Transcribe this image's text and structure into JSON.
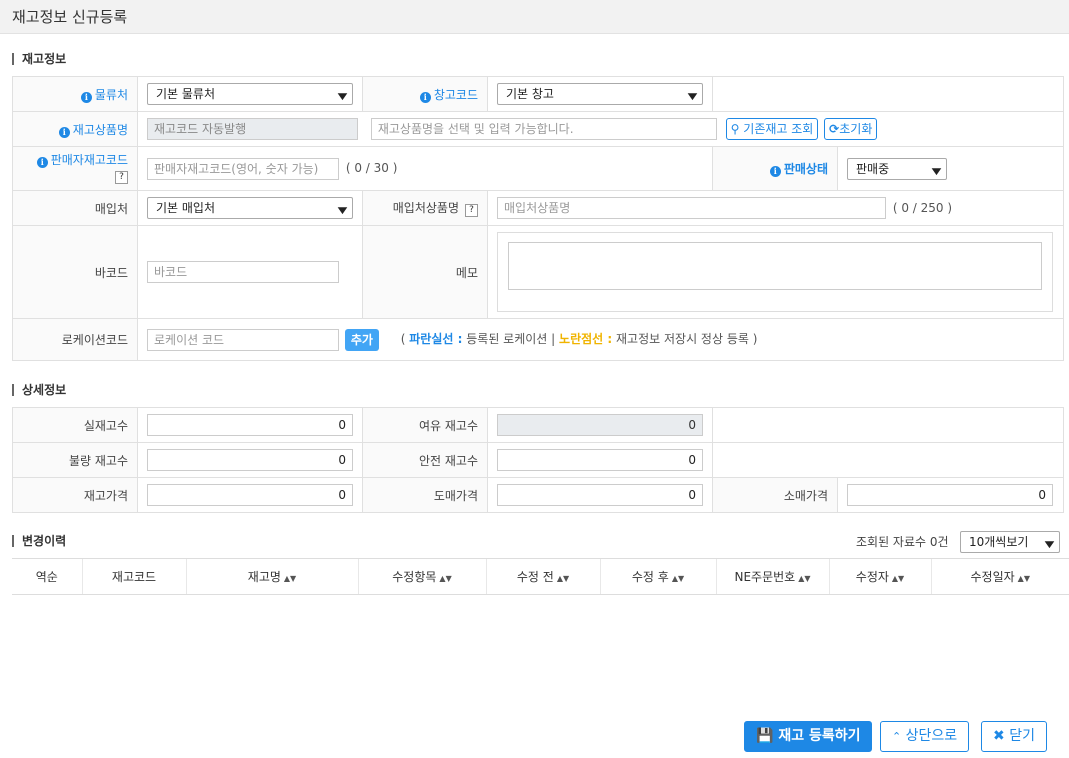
{
  "window": {
    "title": "재고정보 신규등록"
  },
  "sections": {
    "stock_info": "재고정보",
    "detail_info": "상세정보",
    "history": "변경이력"
  },
  "stock": {
    "distributor": {
      "label": "물류처",
      "value": "기본 물류처"
    },
    "warehouse": {
      "label": "창고코드",
      "value": "기본 창고"
    },
    "product_name": {
      "label": "재고상품명",
      "auto_value": "재고코드 자동발행",
      "placeholder": "재고상품명을 선택 및 입력 가능합니다.",
      "lookup_button": "기존재고 조회",
      "reset_button": "초기화"
    },
    "seller_code": {
      "label": "판매자재고코드",
      "help": "?",
      "placeholder": "판매자재고코드(영어, 숫자 가능)",
      "counter": "( 0 / 30 )"
    },
    "sale_status": {
      "label": "판매상태",
      "value": "판매중"
    },
    "purchaser": {
      "label": "매입처",
      "value": "기본 매입처"
    },
    "purchaser_product": {
      "label": "매입처상품명",
      "help": "?",
      "placeholder": "매입처상품명",
      "counter": "( 0 / 250 )"
    },
    "barcode": {
      "label": "바코드",
      "placeholder": "바코드"
    },
    "memo": {
      "label": "메모",
      "value": ""
    },
    "location": {
      "label": "로케이션코드",
      "placeholder": "로케이션 코드",
      "add_button": "추가",
      "legend": {
        "open": "(",
        "blue_term": "파란실선 :",
        "blue_desc": "등록된 로케이션",
        "sep": "|",
        "yellow_term": "노란점선 :",
        "yellow_desc": "재고정보 저장시 정상 등록",
        "close": ")"
      }
    }
  },
  "detail": {
    "actual_qty": {
      "label": "실재고수",
      "value": "0"
    },
    "spare_qty": {
      "label": "여유 재고수",
      "value": "0"
    },
    "defect_qty": {
      "label": "불량 재고수",
      "value": "0"
    },
    "safety_qty": {
      "label": "안전 재고수",
      "value": "0"
    },
    "stock_price": {
      "label": "재고가격",
      "value": "0"
    },
    "wholesale_price": {
      "label": "도매가격",
      "value": "0"
    },
    "retail_price": {
      "label": "소매가격",
      "value": "0"
    }
  },
  "history": {
    "count_text": "조회된 자료수 0건",
    "page_size": "10개씩보기",
    "columns": [
      "역순",
      "재고코드",
      "재고명",
      "수정항목",
      "수정 전",
      "수정 후",
      "NE주문번호",
      "수정자",
      "수정일자"
    ],
    "rows": []
  },
  "footer": {
    "register": "재고 등록하기",
    "top": "상단으로",
    "close": "닫기"
  },
  "colors": {
    "accent": "#1e88e5",
    "yellow": "#f0b400"
  }
}
